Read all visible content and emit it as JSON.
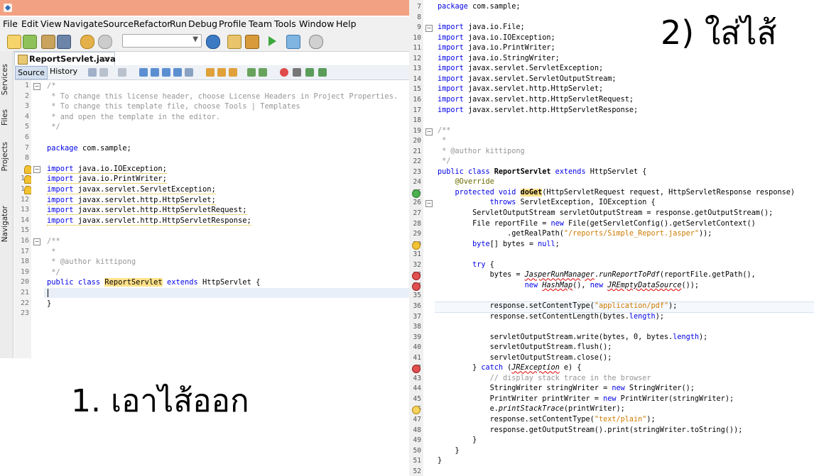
{
  "window": {
    "title": ""
  },
  "menubar": {
    "items": [
      "File",
      "Edit",
      "View",
      "Navigate",
      "Source",
      "Refactor",
      "Run",
      "Debug",
      "Profile",
      "Team",
      "Tools",
      "Window",
      "Help"
    ]
  },
  "sidebar": {
    "tabs": [
      "Services",
      "Files",
      "Projects",
      "Navigator"
    ]
  },
  "editor": {
    "file_tab": "ReportServlet.java",
    "close_glyph": "×",
    "source_tab": "Source",
    "history_tab": "History",
    "lines": [
      {
        "n": "1",
        "t": "/*",
        "c": "cm"
      },
      {
        "n": "2",
        "t": " * To change this license header, choose License Headers in Project Properties.",
        "c": "cm"
      },
      {
        "n": "3",
        "t": " * To change this template file, choose Tools | Templates",
        "c": "cm"
      },
      {
        "n": "4",
        "t": " * and open the template in the editor.",
        "c": "cm"
      },
      {
        "n": "5",
        "t": " */",
        "c": "cm"
      },
      {
        "n": "6",
        "t": ""
      },
      {
        "n": "7",
        "t": "package com.sample;"
      },
      {
        "n": "8",
        "t": ""
      },
      {
        "n": "9",
        "t": "import java.io.IOException;"
      },
      {
        "n": "10",
        "t": "import java.io.PrintWriter;"
      },
      {
        "n": "11",
        "t": "import javax.servlet.ServletException;"
      },
      {
        "n": "12",
        "t": "import javax.servlet.http.HttpServlet;"
      },
      {
        "n": "13",
        "t": "import javax.servlet.http.HttpServletRequest;"
      },
      {
        "n": "14",
        "t": "import javax.servlet.http.HttpServletResponse;"
      },
      {
        "n": "15",
        "t": ""
      },
      {
        "n": "16",
        "t": "/**",
        "c": "cm"
      },
      {
        "n": "17",
        "t": " *",
        "c": "cm"
      },
      {
        "n": "18",
        "t": " * @author kittipong",
        "c": "cm"
      },
      {
        "n": "19",
        "t": " */",
        "c": "cm"
      },
      {
        "n": "20",
        "t": "public class ReportServlet extends HttpServlet {"
      },
      {
        "n": "21",
        "t": ""
      },
      {
        "n": "22",
        "t": "}"
      },
      {
        "n": "23",
        "t": ""
      }
    ]
  },
  "caption_left": "1. เอาไส้ออก",
  "caption_right": "2) ใส่ไส้",
  "right_code": [
    {
      "n": "7",
      "t": "package com.sample;"
    },
    {
      "n": "8",
      "t": ""
    },
    {
      "n": "9",
      "t": "import java.io.File;"
    },
    {
      "n": "10",
      "t": "import java.io.IOException;"
    },
    {
      "n": "11",
      "t": "import java.io.PrintWriter;"
    },
    {
      "n": "12",
      "t": "import java.io.StringWriter;"
    },
    {
      "n": "13",
      "t": "import javax.servlet.ServletException;"
    },
    {
      "n": "14",
      "t": "import javax.servlet.ServletOutputStream;"
    },
    {
      "n": "15",
      "t": "import javax.servlet.http.HttpServlet;"
    },
    {
      "n": "16",
      "t": "import javax.servlet.http.HttpServletRequest;"
    },
    {
      "n": "17",
      "t": "import javax.servlet.http.HttpServletResponse;"
    },
    {
      "n": "18",
      "t": ""
    },
    {
      "n": "19",
      "t": "/**"
    },
    {
      "n": "20",
      "t": " *"
    },
    {
      "n": "21",
      "t": " * @author kittipong"
    },
    {
      "n": "22",
      "t": " */"
    },
    {
      "n": "23",
      "t": "public class ReportServlet extends HttpServlet {"
    },
    {
      "n": "24",
      "t": "    @Override"
    },
    {
      "n": "25",
      "t": "    protected void doGet(HttpServletRequest request, HttpServletResponse response)"
    },
    {
      "n": "26",
      "t": "            throws ServletException, IOException {"
    },
    {
      "n": "27",
      "t": "        ServletOutputStream servletOutputStream = response.getOutputStream();"
    },
    {
      "n": "28",
      "t": "        File reportFile = new File(getServletConfig().getServletContext()"
    },
    {
      "n": "29",
      "t": "                .getRealPath(\"/reports/Simple_Report.jasper\"));"
    },
    {
      "n": "30",
      "t": "        byte[] bytes = null;"
    },
    {
      "n": "31",
      "t": ""
    },
    {
      "n": "32",
      "t": "        try {"
    },
    {
      "n": "33",
      "t": "            bytes = JasperRunManager.runReportToPdf(reportFile.getPath(),"
    },
    {
      "n": "34",
      "t": "                    new HashMap(), new JREmptyDataSource());"
    },
    {
      "n": "35",
      "t": ""
    },
    {
      "n": "36",
      "t": "            response.setContentType(\"application/pdf\");"
    },
    {
      "n": "37",
      "t": "            response.setContentLength(bytes.length);"
    },
    {
      "n": "38",
      "t": ""
    },
    {
      "n": "39",
      "t": "            servletOutputStream.write(bytes, 0, bytes.length);"
    },
    {
      "n": "40",
      "t": "            servletOutputStream.flush();"
    },
    {
      "n": "41",
      "t": "            servletOutputStream.close();"
    },
    {
      "n": "42",
      "t": "        } catch (JRException e) {"
    },
    {
      "n": "43",
      "t": "            // display stack trace in the browser"
    },
    {
      "n": "44",
      "t": "            StringWriter stringWriter = new StringWriter();"
    },
    {
      "n": "45",
      "t": "            PrintWriter printWriter = new PrintWriter(stringWriter);"
    },
    {
      "n": "46",
      "t": "            e.printStackTrace(printWriter);"
    },
    {
      "n": "47",
      "t": "            response.setContentType(\"text/plain\");"
    },
    {
      "n": "48",
      "t": "            response.getOutputStream().print(stringWriter.toString());"
    },
    {
      "n": "49",
      "t": "        }"
    },
    {
      "n": "50",
      "t": "    }"
    },
    {
      "n": "51",
      "t": "}"
    },
    {
      "n": "52",
      "t": ""
    }
  ],
  "colors": {
    "titlebar": "#f3a183",
    "keyword": "#0000e6",
    "comment": "#969696",
    "string": "#ce7b00",
    "highlight": "#ffe28a"
  }
}
